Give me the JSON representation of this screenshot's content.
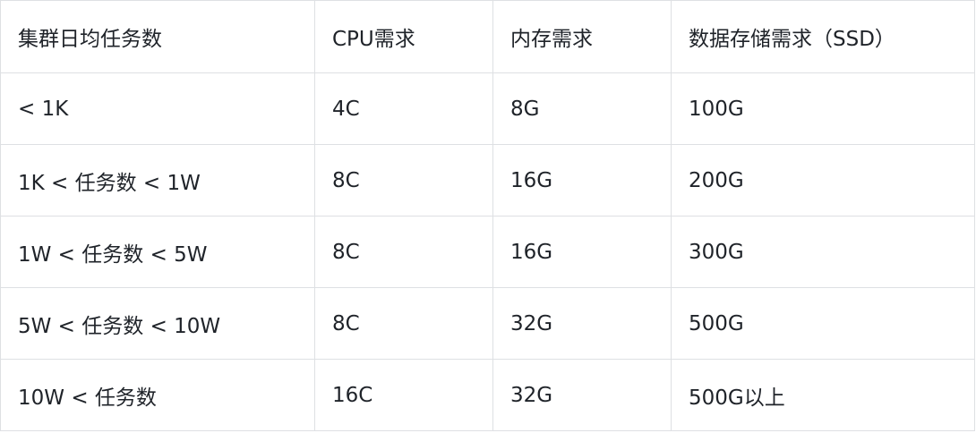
{
  "table": {
    "headers": [
      "集群日均任务数",
      "CPU需求",
      "内存需求",
      "数据存储需求（SSD）"
    ],
    "rows": [
      [
        "< 1K",
        "4C",
        "8G",
        "100G"
      ],
      [
        "1K < 任务数 < 1W",
        "8C",
        "16G",
        "200G"
      ],
      [
        "1W < 任务数 < 5W",
        "8C",
        "16G",
        "300G"
      ],
      [
        "5W < 任务数 < 10W",
        "8C",
        "32G",
        "500G"
      ],
      [
        "10W < 任务数",
        "16C",
        "32G",
        "500G以上"
      ]
    ]
  }
}
